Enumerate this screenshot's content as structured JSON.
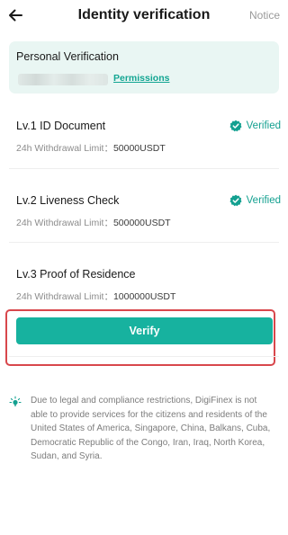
{
  "header": {
    "title": "Identity verification",
    "notice_label": "Notice"
  },
  "personal": {
    "title": "Personal Verification",
    "permissions_label": "Permissions"
  },
  "levels": [
    {
      "title": "Lv.1 ID Document",
      "limit_label": "24h Withdrawal Limit：",
      "limit_value": "50000USDT",
      "status": "Verified"
    },
    {
      "title": "Lv.2 Liveness Check",
      "limit_label": "24h Withdrawal Limit：",
      "limit_value": "500000USDT",
      "status": "Verified"
    },
    {
      "title": "Lv.3 Proof of Residence",
      "limit_label": "24h Withdrawal Limit：",
      "limit_value": "1000000USDT"
    }
  ],
  "verify_label": "Verify",
  "disclaimer": "Due to legal and compliance restrictions, DigiFinex is not able to provide services for the citizens and residents of the United States of America, Singapore, China, Balkans, Cuba, Democratic Republic of the Congo, Iran, Iraq, North Korea, Sudan, and Syria.",
  "colors": {
    "accent": "#17b29f",
    "card_bg": "#e9f6f3",
    "highlight": "#d8474c"
  },
  "icons": {
    "back": "arrow-left-icon",
    "verified": "verified-badge-icon",
    "tip": "bulb-icon"
  }
}
